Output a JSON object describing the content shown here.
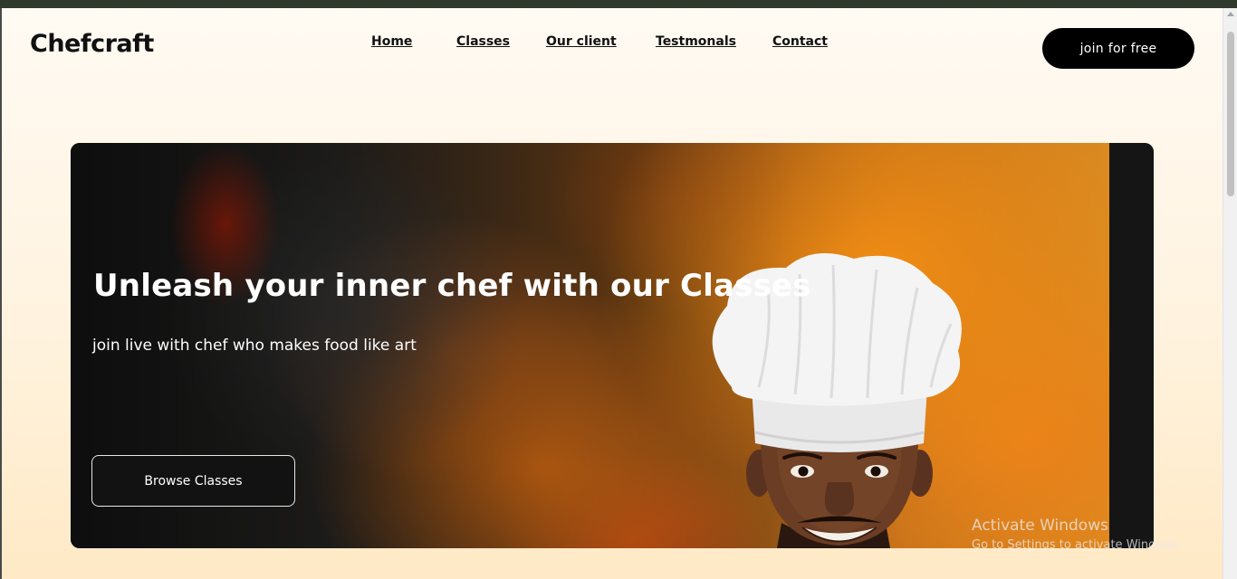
{
  "header": {
    "logo": "Chefcraft",
    "nav": [
      {
        "label": "Home"
      },
      {
        "label": "Classes"
      },
      {
        "label": "Our client"
      },
      {
        "label": "Testmonals"
      },
      {
        "label": "Contact"
      }
    ],
    "cta_label": "join for free"
  },
  "hero": {
    "title": "Unleash your inner chef with our Classes",
    "subtitle": "join live with chef who makes food like art",
    "button_label": "Browse Classes",
    "image_subject": "smiling chef in white toque in front of blurred cooking flames"
  },
  "os_watermark": {
    "title": "Activate Windows",
    "subtitle": "Go to Settings to activate Windows."
  },
  "colors": {
    "page_background": "#fff3df",
    "primary_button": "#000000",
    "text_dark": "#111111",
    "hero_text": "#ffffff"
  },
  "icons": [
    "scroll-up-arrow-icon"
  ]
}
